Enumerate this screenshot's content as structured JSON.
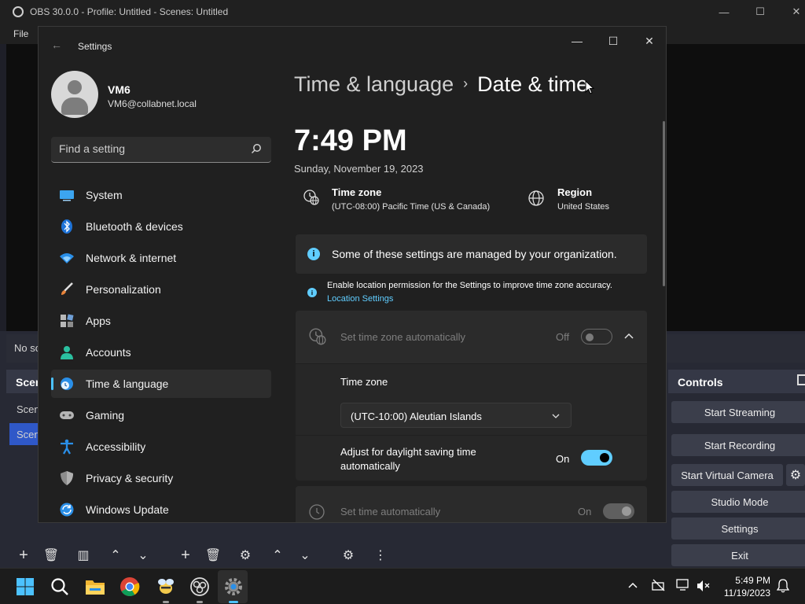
{
  "obs": {
    "title": "OBS 30.0.0 - Profile: Untitled - Scenes: Untitled",
    "menu_file": "File",
    "no_source": "No so",
    "scenes_header": "Scen",
    "scene_item_1": "Scen",
    "scene_item_2": "Scen",
    "controls_header": "Controls",
    "controls": {
      "start_streaming": "Start Streaming",
      "start_recording": "Start Recording",
      "start_virtual_camera": "Start Virtual Camera",
      "studio_mode": "Studio Mode",
      "settings": "Settings",
      "exit": "Exit"
    }
  },
  "settings": {
    "window_title": "Settings",
    "user": {
      "name": "VM6",
      "email": "VM6@collabnet.local"
    },
    "search": {
      "placeholder": "Find a setting"
    },
    "nav": [
      {
        "label": "System",
        "icon": "monitor-icon"
      },
      {
        "label": "Bluetooth & devices",
        "icon": "bluetooth-icon"
      },
      {
        "label": "Network & internet",
        "icon": "wifi-icon"
      },
      {
        "label": "Personalization",
        "icon": "brush-icon"
      },
      {
        "label": "Apps",
        "icon": "apps-icon"
      },
      {
        "label": "Accounts",
        "icon": "person-icon"
      },
      {
        "label": "Time & language",
        "icon": "globe-clock-icon",
        "active": true
      },
      {
        "label": "Gaming",
        "icon": "gamepad-icon"
      },
      {
        "label": "Accessibility",
        "icon": "accessibility-icon"
      },
      {
        "label": "Privacy & security",
        "icon": "shield-icon"
      },
      {
        "label": "Windows Update",
        "icon": "update-icon"
      }
    ],
    "breadcrumb": {
      "parent": "Time & language",
      "separator": "›",
      "current": "Date & time"
    },
    "clock": "7:49 PM",
    "date": "Sunday, November 19, 2023",
    "time_zone_info": {
      "title": "Time zone",
      "value": "(UTC-08:00) Pacific Time (US & Canada)"
    },
    "region_info": {
      "title": "Region",
      "value": "United States"
    },
    "org_banner": "Some of these settings are managed by your organization.",
    "location_notice": "Enable location permission for the Settings to improve time zone accuracy.",
    "location_link": "Location Settings",
    "auto_tz": {
      "label": "Set time zone automatically",
      "state": "Off"
    },
    "tz_select": {
      "label": "Time zone",
      "value": "(UTC-10:00) Aleutian Islands"
    },
    "dst": {
      "label_line1": "Adjust for daylight saving time",
      "label_line2": "automatically",
      "state": "On"
    },
    "auto_time": {
      "label": "Set time automatically",
      "state": "On"
    }
  },
  "taskbar": {
    "time": "5:49 PM",
    "date": "11/19/2023"
  },
  "colors": {
    "accent": "#60cdff",
    "background": "#202020",
    "card": "#2b2b2b"
  }
}
